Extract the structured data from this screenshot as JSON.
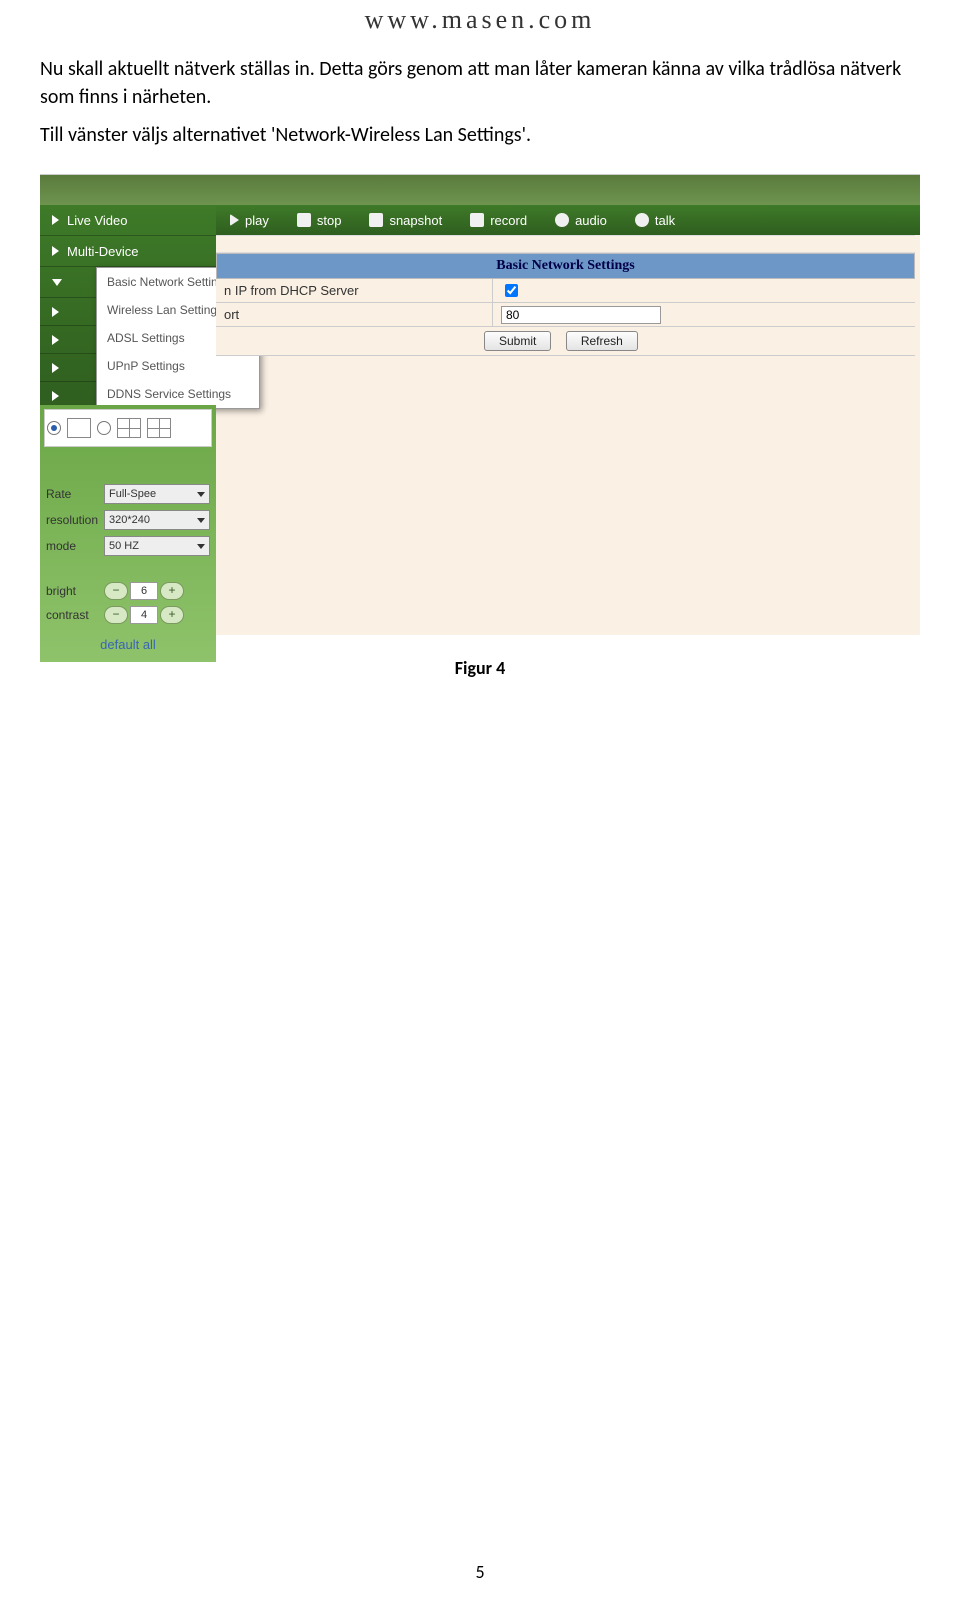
{
  "header_url": "www.masen.com",
  "paragraph1": "Nu skall aktuellt nätverk ställas in. Detta görs genom att man låter kameran känna av vilka trådlösa nätverk som finns i närheten.",
  "paragraph2": "Till vänster väljs alternativet 'Network-Wireless Lan Settings'.",
  "figure_caption": "Figur 4",
  "page_number": "5",
  "toolbar": {
    "play": "play",
    "stop": "stop",
    "snapshot": "snapshot",
    "record": "record",
    "audio": "audio",
    "talk": "talk"
  },
  "sidebar": {
    "live_video": "Live Video",
    "multi_device": "Multi-Device"
  },
  "popup": {
    "items": [
      "Basic Network Settings",
      "Wireless Lan Settings",
      "ADSL Settings",
      "UPnP Settings",
      "DDNS Service Settings"
    ]
  },
  "form": {
    "title": "Basic Network Settings",
    "row1_label_fragment": "n IP from DHCP Server",
    "row2_label_fragment": "ort",
    "port_value": "80",
    "submit": "Submit",
    "refresh": "Refresh"
  },
  "controls": {
    "rate_label": "Rate",
    "rate_value": "Full-Spee",
    "resolution_label": "resolution",
    "resolution_value": "320*240",
    "mode_label": "mode",
    "mode_value": "50 HZ",
    "bright_label": "bright",
    "bright_value": "6",
    "contrast_label": "contrast",
    "contrast_value": "4",
    "default_all": "default all"
  }
}
